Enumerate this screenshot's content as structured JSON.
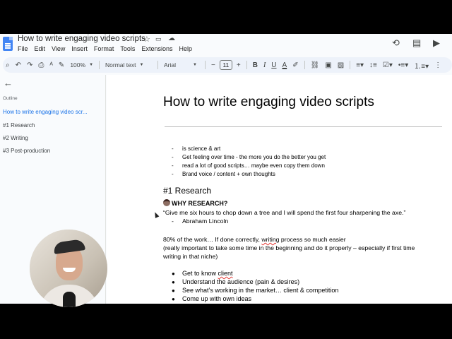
{
  "doc": {
    "title": "How to write engaging video scripts"
  },
  "menu": [
    "File",
    "Edit",
    "View",
    "Insert",
    "Format",
    "Tools",
    "Extensions",
    "Help"
  ],
  "toolbar": {
    "zoom": "100%",
    "style": "Normal text",
    "font": "Arial",
    "font_size": "11",
    "minus": "−",
    "plus": "+"
  },
  "sidebar": {
    "outline_label": "Outline",
    "items": [
      "How to write engaging video scr...",
      "#1 Research",
      "#2 Writing",
      "#3 Post-production"
    ],
    "active_color": "#1a73e8"
  },
  "content": {
    "heading": "How to write engaging video scripts",
    "intro_bullets": [
      "is science & art",
      "Get feeling over time - the more you do the better you get",
      "read a lot of good scripts… maybe even copy them down",
      "Brand voice / content + own thoughts"
    ],
    "section_heading": "#1 Research",
    "why_label": "WHY RESEARCH?",
    "quote": "“Give me six hours to chop down a tree and I will spend the first four sharpening the axe.”",
    "quote_author": "Abraham Lincoln",
    "p1_a": "80% of the work… If done correctly, ",
    "p1_b": "writing",
    "p1_c": " process so much easier",
    "p2": "(really important to take some time in the beginning and do it properly – especially if first time",
    "p3": "writing in that niche)",
    "research_bullets": [
      {
        "pre": "Get to know ",
        "squig": "client",
        "post": ""
      },
      {
        "pre": "Understand the audience (pain & desires)",
        "squig": "",
        "post": ""
      },
      {
        "pre": "See what’s working in the market… client & competition",
        "squig": "",
        "post": ""
      },
      {
        "pre": "Come up with own ideas",
        "squig": "",
        "post": ""
      }
    ]
  },
  "icons": {
    "dash": "-",
    "dot": "●"
  }
}
